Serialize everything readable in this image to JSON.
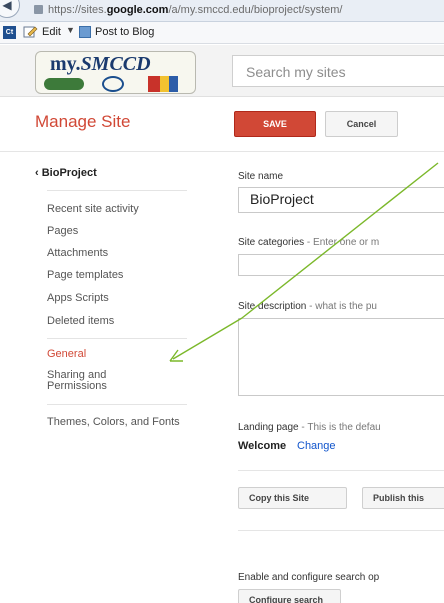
{
  "browser": {
    "url_prefix": "https://sites.",
    "url_domain": "google.com",
    "url_suffix": "/a/my.smccd.edu/bioproject/system/",
    "bookmark_ct": "Ct",
    "edit_label": "Edit",
    "post_label": "Post to Blog"
  },
  "header": {
    "logo_prefix": "my.",
    "logo_name": "SMCCD",
    "search_placeholder": "Search my sites"
  },
  "toolbar": {
    "title": "Manage Site",
    "save_label": "SAVE",
    "cancel_label": "Cancel"
  },
  "sidebar": {
    "back_label": "BioProject",
    "items": [
      "Recent site activity",
      "Pages",
      "Attachments",
      "Page templates",
      "Apps Scripts",
      "Deleted items",
      "General",
      "Sharing and Permissions",
      "Themes, Colors, and Fonts"
    ],
    "active_item": "General"
  },
  "form": {
    "site_name_label": "Site name",
    "site_name_value": "BioProject",
    "categories_label": "Site categories",
    "categories_hint": " - Enter one or m",
    "description_label": "Site description",
    "description_hint": " - what is the pu",
    "landing_label": "Landing page",
    "landing_hint": " - This is the defau",
    "landing_value": "Welcome",
    "change_link": "Change",
    "copy_button": "Copy this Site",
    "publish_button": "Publish this",
    "search_text": "Enable and configure search op",
    "configure_button": "Configure search"
  },
  "colors": {
    "accent": "#d14836",
    "link": "#1155cc",
    "annotation": "#7bb82a"
  }
}
